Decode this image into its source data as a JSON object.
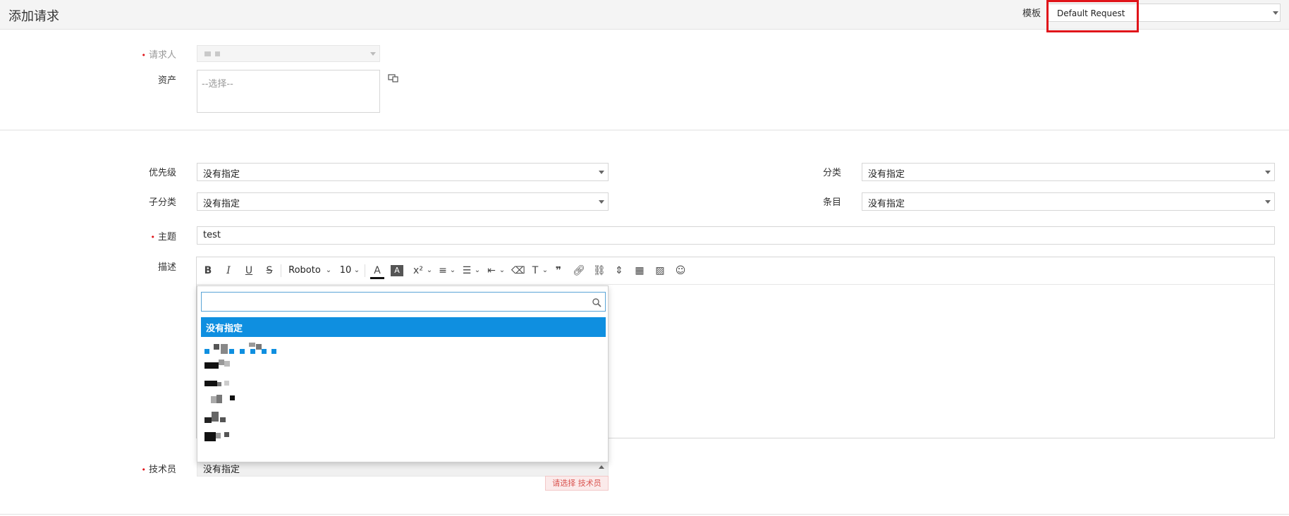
{
  "header": {
    "title": "添加请求",
    "template_label": "模板",
    "template_value": "Default Request"
  },
  "requester": {
    "label": "请求人"
  },
  "asset": {
    "label": "资产",
    "placeholder": "--选择--"
  },
  "priority": {
    "label": "优先级",
    "value": "没有指定"
  },
  "category": {
    "label": "分类",
    "value": "没有指定"
  },
  "subcategory": {
    "label": "子分类",
    "value": "没有指定"
  },
  "item": {
    "label": "条目",
    "value": "没有指定"
  },
  "subject": {
    "label": "主题",
    "value": "test"
  },
  "description": {
    "label": "描述",
    "font_family": "Roboto",
    "font_size": "10"
  },
  "technician": {
    "label": "技术员",
    "value": "没有指定",
    "error": "请选择 技术员",
    "dropdown": {
      "selected_option": "没有指定"
    }
  },
  "colors": {
    "accent": "#0f8fe0",
    "required": "#e0141a",
    "highlight_box": "#e0141a"
  }
}
